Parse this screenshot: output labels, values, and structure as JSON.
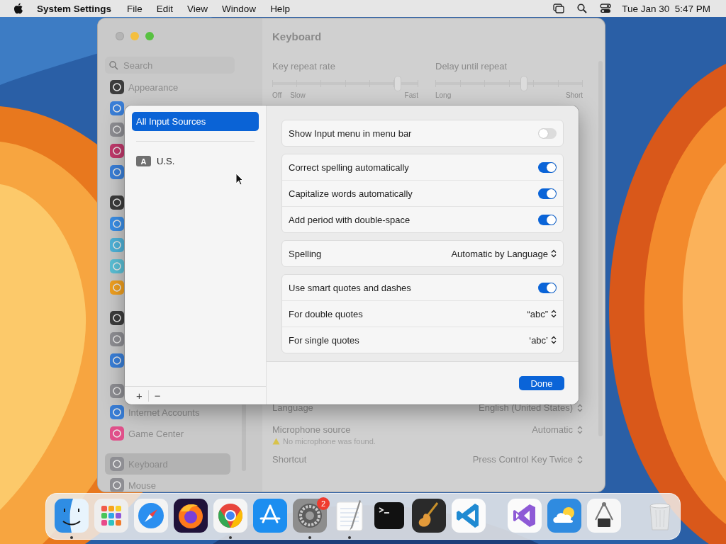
{
  "menu_bar": {
    "app": "System Settings",
    "menus": [
      "File",
      "Edit",
      "View",
      "Window",
      "Help"
    ],
    "clock": "Tue Jan 30  5:47 PM"
  },
  "settings_window": {
    "title": "Keyboard",
    "search": {
      "placeholder": "Search"
    },
    "sidebar": {
      "groups": [
        {
          "items": [
            {
              "label": "Appearance",
              "color": "#3c3c3c",
              "selected": false
            },
            {
              "color": "#3a7fd8",
              "selected": false
            },
            {
              "color": "#8e8e93",
              "selected": false
            },
            {
              "color": "#c0396b",
              "selected": false
            },
            {
              "color": "#3a7fd8",
              "selected": false
            }
          ]
        },
        {
          "items": [
            {
              "color": "#3c3c3c",
              "selected": false
            },
            {
              "color": "#3a8ee6",
              "selected": false
            },
            {
              "color": "#4fb3d9",
              "selected": false
            },
            {
              "color": "#5ac0d6",
              "selected": false
            },
            {
              "color": "#f0a020",
              "selected": false
            }
          ]
        },
        {
          "items": [
            {
              "color": "#3c3c3c",
              "selected": false
            },
            {
              "color": "#8e8e93",
              "selected": false
            },
            {
              "color": "#3a7fd8",
              "selected": false
            }
          ]
        },
        {
          "items": [
            {
              "color": "#8e8e93",
              "selected": false
            },
            {
              "label": "Internet Accounts",
              "color": "#3a7fd8",
              "selected": false
            },
            {
              "label": "Game Center",
              "color": "#e0508a",
              "selected": false
            }
          ]
        },
        {
          "items": [
            {
              "label": "Keyboard",
              "color": "#8e8e93",
              "selected": true
            },
            {
              "label": "Mouse",
              "color": "#8e8e93",
              "selected": false
            }
          ]
        }
      ]
    },
    "sliders": [
      {
        "label": "Key repeat rate",
        "level": 0.86,
        "start_labels": [
          "Off",
          "Slow"
        ],
        "end_label": "Fast"
      },
      {
        "label": "Delay until repeat",
        "level": 0.6,
        "start_labels": [
          "Long"
        ],
        "end_label": "Short"
      }
    ],
    "rows": [
      {
        "label": "Language",
        "value": "English (United States)"
      },
      {
        "label": "Microphone source",
        "value": "Automatic",
        "warning": "No microphone was found."
      },
      {
        "label": "Shortcut",
        "value": "Press Control Key Twice"
      }
    ]
  },
  "sheet": {
    "sources": [
      {
        "label": "All Input Sources",
        "selected": true
      },
      {
        "label": "U.S.",
        "badge": "A",
        "selected": false
      }
    ],
    "add": "+",
    "remove": "−",
    "groups": [
      {
        "items": [
          {
            "kind": "toggle",
            "label": "Show Input menu in menu bar",
            "on": false
          }
        ]
      },
      {
        "items": [
          {
            "kind": "toggle",
            "label": "Correct spelling automatically",
            "on": true
          },
          {
            "kind": "toggle",
            "label": "Capitalize words automatically",
            "on": true
          },
          {
            "kind": "toggle",
            "label": "Add period with double-space",
            "on": true
          }
        ]
      },
      {
        "items": [
          {
            "kind": "popup",
            "label": "Spelling",
            "value": "Automatic by Language"
          }
        ]
      },
      {
        "items": [
          {
            "kind": "toggle",
            "label": "Use smart quotes and dashes",
            "on": true
          },
          {
            "kind": "popup",
            "label": "For double quotes",
            "value": "“abc”"
          },
          {
            "kind": "popup",
            "label": "For single quotes",
            "value": "‘abc’"
          }
        ]
      }
    ],
    "done": "Done"
  },
  "dock": {
    "sections": [
      {
        "apps": [
          {
            "kind": "finder",
            "running": true
          },
          {
            "kind": "launchpad",
            "running": false
          },
          {
            "kind": "safari",
            "running": false
          },
          {
            "kind": "firefox",
            "running": false
          },
          {
            "kind": "chrome",
            "running": true
          },
          {
            "kind": "appstore",
            "running": false
          },
          {
            "kind": "settings",
            "running": true,
            "badge": "2"
          },
          {
            "kind": "textedit",
            "running": true
          },
          {
            "kind": "terminal",
            "running": false
          },
          {
            "kind": "garageband",
            "running": false
          },
          {
            "kind": "vscode",
            "running": false
          }
        ]
      },
      {
        "apps": [
          {
            "kind": "vstudio",
            "running": false
          },
          {
            "kind": "weather",
            "running": false
          },
          {
            "kind": "sysinfo",
            "running": false
          }
        ]
      },
      {
        "apps": [
          {
            "kind": "trash",
            "running": false
          }
        ]
      }
    ]
  }
}
